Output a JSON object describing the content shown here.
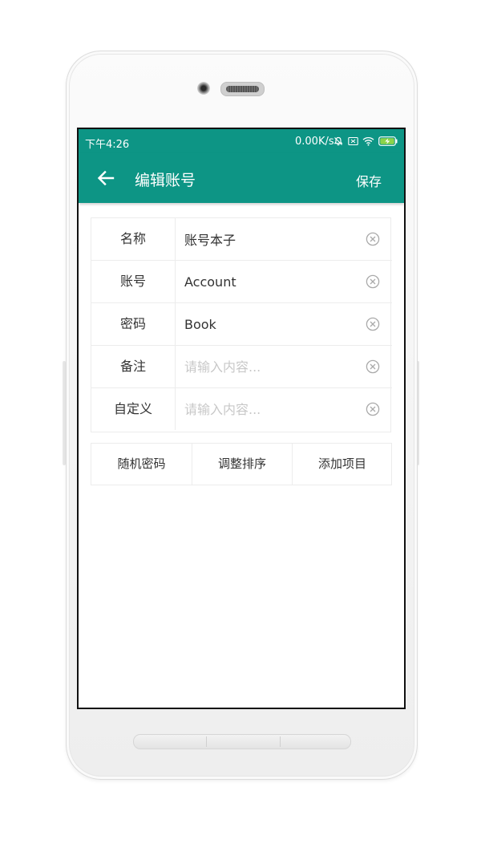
{
  "status_bar": {
    "time": "下午4:26",
    "network_speed": "0.00K/s",
    "icons": [
      "mute-icon",
      "sim-off-icon",
      "wifi-icon",
      "battery-charging-icon"
    ],
    "background_color": "#0d9585"
  },
  "app_bar": {
    "title": "编辑账号",
    "save_label": "保存",
    "back_icon": "back-arrow-icon",
    "color": "#0d9585"
  },
  "form": {
    "fields": [
      {
        "label": "名称",
        "value": "账号本子",
        "placeholder": ""
      },
      {
        "label": "账号",
        "value": "Account",
        "placeholder": ""
      },
      {
        "label": "密码",
        "value": "Book",
        "placeholder": ""
      },
      {
        "label": "备注",
        "value": "",
        "placeholder": "请输入内容..."
      },
      {
        "label": "自定义",
        "value": "",
        "placeholder": "请输入内容..."
      }
    ],
    "clear_icon": "clear-circle-icon"
  },
  "actions": {
    "random_password": "随机密码",
    "adjust_order": "调整排序",
    "add_item": "添加项目"
  }
}
